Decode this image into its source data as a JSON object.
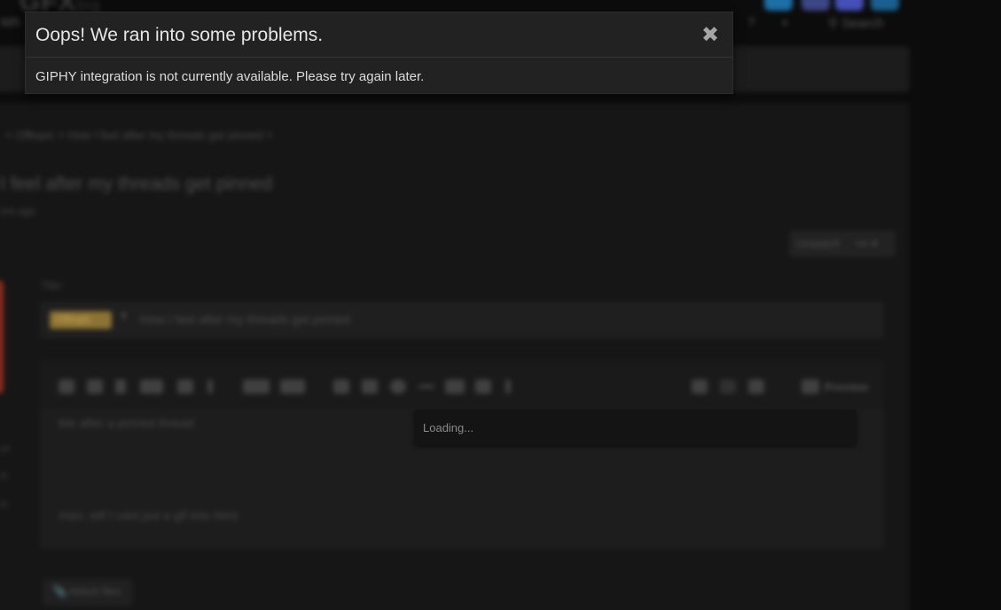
{
  "background_page": {
    "logo_text": "GFX",
    "logo_suffix": "big",
    "nav": {
      "left_label": "Wh",
      "search_label": "Search"
    },
    "breadcrumb": "< Offtopic > How I feel after my threads get pinned >",
    "thread_title": "I feel after my threads get pinned",
    "thread_meta": "ent ago",
    "unwatch_label": "Unwatch",
    "more_label": "••• ▾",
    "sidebar_snippets": [
      "ys",
      "ts",
      "ts"
    ],
    "title_field_label": "Title:",
    "prefix_label": "Offtopic",
    "title_field_value": "How I feel after my threads get pinned",
    "preview_label": "Preview",
    "editor_lines": [
      "Me after a pinned thread",
      "man, wtf I cant put a gif into here"
    ],
    "attach_label": "Attach files"
  },
  "giphy_dropdown": {
    "status_text": "Loading..."
  },
  "error_overlay": {
    "title": "Oops! We ran into some problems.",
    "message": "GIPHY integration is not currently available. Please try again later.",
    "close_glyph": "✖"
  },
  "colors": {
    "overlay_bg": "#222222",
    "page_bg": "#0c0c0c",
    "prefix_badge": "#8d7333",
    "social_icons": [
      "#1da1f2",
      "#4a5aa8",
      "#5865f2",
      "#0077b5"
    ]
  },
  "icons": [
    "close-icon",
    "question-icon",
    "theme-toggle-icon",
    "search-icon",
    "bold-icon",
    "italic-icon",
    "link-icon",
    "image-icon",
    "undo-icon",
    "redo-icon",
    "preview-icon",
    "attach-icon"
  ]
}
